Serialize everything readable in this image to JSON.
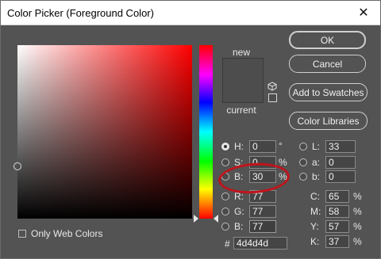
{
  "window": {
    "title": "Color Picker (Foreground Color)"
  },
  "preview": {
    "new_label": "new",
    "current_label": "current",
    "color": "#4d4d4d"
  },
  "buttons": {
    "ok": "OK",
    "cancel": "Cancel",
    "add_to_swatches": "Add to Swatches",
    "color_libraries": "Color Libraries"
  },
  "hsb": {
    "h": {
      "label": "H:",
      "value": "0",
      "unit": "°"
    },
    "s": {
      "label": "S:",
      "value": "0",
      "unit": "%"
    },
    "b": {
      "label": "B:",
      "value": "30",
      "unit": "%"
    }
  },
  "rgb": {
    "r": {
      "label": "R:",
      "value": "77"
    },
    "g": {
      "label": "G:",
      "value": "77"
    },
    "b": {
      "label": "B:",
      "value": "77"
    }
  },
  "lab": {
    "l": {
      "label": "L:",
      "value": "33"
    },
    "a": {
      "label": "a:",
      "value": "0"
    },
    "b": {
      "label": "b:",
      "value": "0"
    }
  },
  "cmyk": {
    "c": {
      "label": "C:",
      "value": "65",
      "unit": "%"
    },
    "m": {
      "label": "M:",
      "value": "58",
      "unit": "%"
    },
    "y": {
      "label": "Y:",
      "value": "57",
      "unit": "%"
    },
    "k": {
      "label": "K:",
      "value": "37",
      "unit": "%"
    }
  },
  "hex": {
    "label": "#",
    "value": "4d4d4d"
  },
  "web_colors": {
    "label": "Only Web Colors"
  },
  "colors": {
    "annotation": "#c0141b",
    "background": "#535353"
  }
}
